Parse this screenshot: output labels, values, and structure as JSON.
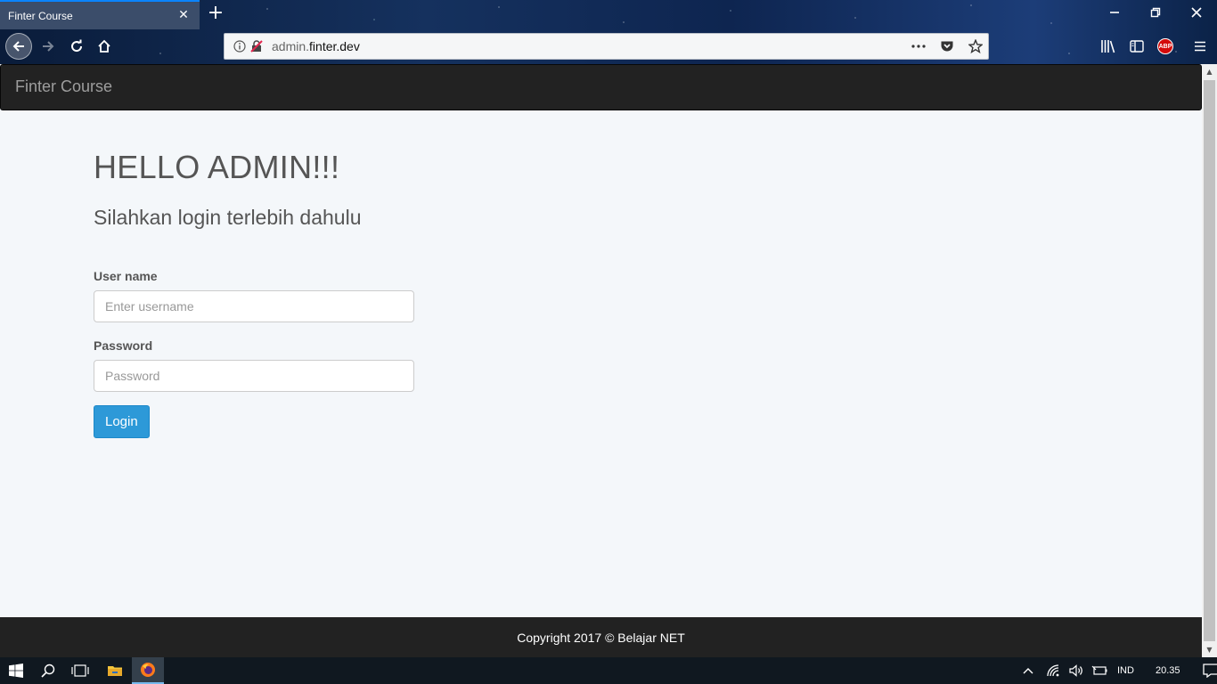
{
  "browser": {
    "tab_title": "Finter Course",
    "url_prefix": "admin.",
    "url_domain": "finter.dev",
    "icons": [
      "close-icon",
      "plus-icon",
      "minimize-icon",
      "restore-icon",
      "close-window-icon",
      "back-arrow-icon",
      "forward-arrow-icon",
      "reload-icon",
      "home-icon",
      "info-icon",
      "insecure-lock-icon",
      "more-icon",
      "pocket-icon",
      "star-icon",
      "library-icon",
      "sidebar-icon",
      "adblock-icon",
      "menu-icon"
    ],
    "adblock_label": "ABP",
    "accent_color": "#0a84ff"
  },
  "site": {
    "brand": "Finter Course",
    "heading": "HELLO ADMIN!!!",
    "subheading": "Silahkan login terlebih dahulu",
    "form": {
      "username_label": "User name",
      "username_placeholder": "Enter username",
      "password_label": "Password",
      "password_placeholder": "Password",
      "login_label": "Login"
    },
    "footer": "Copyright 2017 © Belajar NET",
    "colors": {
      "navbar": "#222222",
      "button": "#2d99d8",
      "background": "#f4f7fa"
    }
  },
  "taskbar": {
    "language": "IND",
    "time": "20.35"
  }
}
